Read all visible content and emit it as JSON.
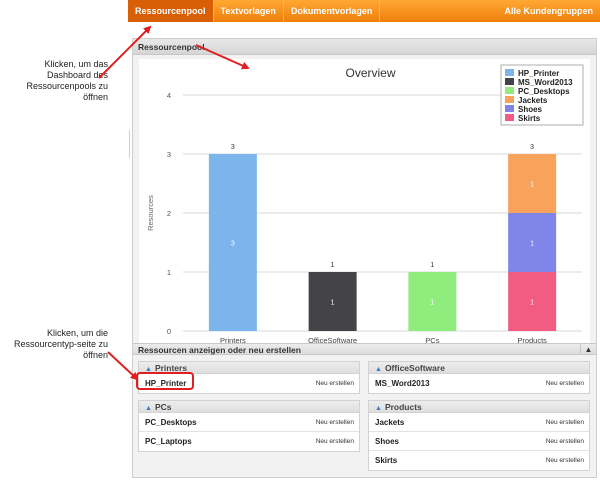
{
  "nav": {
    "tabs": [
      {
        "label": "Ressourcenpool",
        "active": true
      },
      {
        "label": "Textvorlagen"
      },
      {
        "label": "Dokumentvorlagen"
      }
    ],
    "right_tab": "Alle Kundengruppen"
  },
  "panel": {
    "title": "Ressourcenpool"
  },
  "chart_data": {
    "type": "bar",
    "stacked": true,
    "title": "Overview",
    "ylabel": "Resources",
    "xlabel": "",
    "ylim": [
      0,
      4
    ],
    "yticks": [
      0,
      1,
      2,
      3,
      4
    ],
    "grid": true,
    "legend_position": "top-right",
    "categories": [
      "Printers",
      "OfficeSoftware",
      "PCs",
      "Products"
    ],
    "series": [
      {
        "name": "HP_Printer",
        "color": "#7cb5ec",
        "values": [
          3,
          0,
          0,
          0
        ]
      },
      {
        "name": "MS_Word2013",
        "color": "#434348",
        "values": [
          0,
          1,
          0,
          0
        ]
      },
      {
        "name": "PC_Desktops",
        "color": "#90ed7d",
        "values": [
          0,
          0,
          1,
          0
        ]
      },
      {
        "name": "Skirts",
        "color": "#f15c80",
        "values": [
          0,
          0,
          0,
          1
        ]
      },
      {
        "name": "Shoes",
        "color": "#8085e9",
        "values": [
          0,
          0,
          0,
          1
        ]
      },
      {
        "name": "Jackets",
        "color": "#f7a35c",
        "values": [
          0,
          0,
          0,
          1
        ]
      }
    ],
    "legend_order": [
      "HP_Printer",
      "MS_Word2013",
      "PC_Desktops",
      "Jackets",
      "Shoes",
      "Skirts"
    ],
    "totals": [
      3,
      1,
      1,
      3
    ]
  },
  "subpanel": {
    "title": "Ressourcen anzeigen oder neu erstellen",
    "groups": [
      {
        "title": "Printers",
        "items": [
          {
            "name": "HP_Printer",
            "action": "Neu erstellen"
          }
        ]
      },
      {
        "title": "OfficeSoftware",
        "items": [
          {
            "name": "MS_Word2013",
            "action": "Neu erstellen"
          }
        ]
      },
      {
        "title": "PCs",
        "items": [
          {
            "name": "PC_Desktops",
            "action": "Neu erstellen"
          },
          {
            "name": "PC_Laptops",
            "action": "Neu erstellen"
          }
        ]
      },
      {
        "title": "Products",
        "items": [
          {
            "name": "Jackets",
            "action": "Neu erstellen"
          },
          {
            "name": "Shoes",
            "action": "Neu erstellen"
          },
          {
            "name": "Skirts",
            "action": "Neu erstellen"
          }
        ]
      }
    ]
  },
  "annotations": {
    "dashboard": "Klicken, um das Dashboard des Ressourcenpools zu öffnen",
    "resource_type": "Klicken, um die Ressourcentyp-seite zu öffnen"
  },
  "colors": {
    "accent": "#f07f0c",
    "annotation": "#e02020"
  }
}
